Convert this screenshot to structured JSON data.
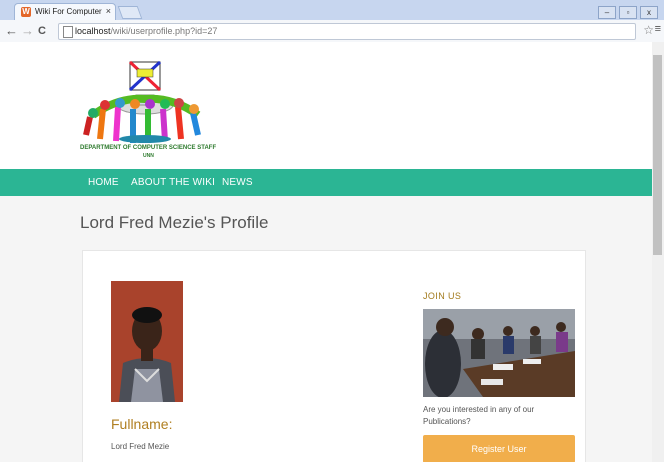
{
  "browser": {
    "tab_title": "Wiki For Computer Scienc",
    "tab_close": "×",
    "back": "←",
    "forward": "→",
    "reload": "C",
    "url_host": "localhost",
    "url_path": "/wiki/userprofile.php?id=27",
    "star": "☆",
    "menu": "≡",
    "win_min": "–",
    "win_max": "▫",
    "win_close": "x"
  },
  "site": {
    "logo_text": "DEPARTMENT OF COMPUTER SCIENCE STAFF",
    "logo_sub": "UNN",
    "nav": [
      "HOME",
      "ABOUT THE WIKI",
      "NEWS"
    ]
  },
  "profile": {
    "title": "Lord Fred Mezie's Profile",
    "fullname_label": "Fullname:",
    "fullname_value": "Lord Fred Mezie"
  },
  "sidebar": {
    "join_label": "JOIN US",
    "join_text": "Are you interested in any of our Publications?",
    "register_button": "Register User"
  },
  "colors": {
    "nav_bg": "#2bb594",
    "accent_gold": "#b07f21",
    "register_bg": "#f1ae4b"
  }
}
